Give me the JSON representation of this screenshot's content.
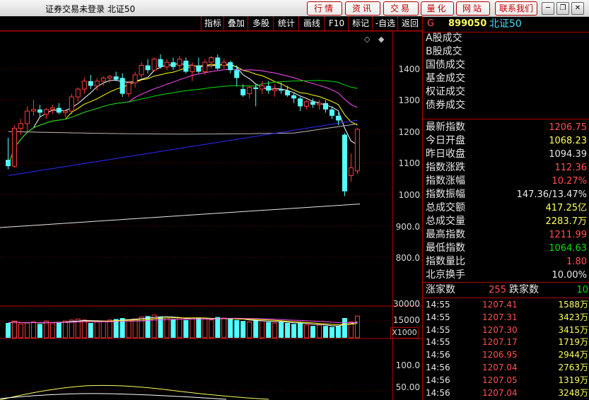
{
  "title": "证券交易未登录  北证50",
  "nav_buttons": [
    "行情",
    "资讯",
    "交易",
    "量化",
    "网站",
    "联系我们"
  ],
  "window_buttons": {
    "minimize": "─",
    "restore": "❐",
    "close": "✕"
  },
  "toolbar": [
    "指标",
    "叠加",
    "多股",
    "统计",
    "画线",
    "F10",
    "标记",
    "-自选",
    "返回"
  ],
  "chart": {
    "price_ticks": [
      "1400",
      "1300",
      "1200",
      "1100",
      "1000",
      "900.0",
      "800.0"
    ],
    "volume_ticks": [
      "30000",
      "15000"
    ],
    "volume_unit": "X1000",
    "indicator_ticks": [
      "100.0",
      "50.00"
    ],
    "colors": {
      "up": "#ff3c3c",
      "down": "#54ffff",
      "ma5": "#ffffff",
      "ma10": "#ffff00",
      "ma20": "#ff50ff",
      "ma60": "#00e000",
      "ma120": "#b8b8b8",
      "ma250": "#2a2aff",
      "ma_long": "#e8e8e8"
    }
  },
  "chart_data": {
    "type": "candlestick",
    "ylim": [
      760,
      1450
    ],
    "candles": [
      [
        1110,
        1180,
        1080,
        1090
      ],
      [
        1090,
        1220,
        1085,
        1210
      ],
      [
        1210,
        1240,
        1190,
        1225
      ],
      [
        1225,
        1280,
        1200,
        1265
      ],
      [
        1265,
        1300,
        1250,
        1270
      ],
      [
        1270,
        1285,
        1245,
        1260
      ],
      [
        1255,
        1275,
        1240,
        1270
      ],
      [
        1270,
        1285,
        1255,
        1275
      ],
      [
        1275,
        1290,
        1255,
        1260
      ],
      [
        1260,
        1270,
        1245,
        1265
      ],
      [
        1265,
        1320,
        1255,
        1310
      ],
      [
        1310,
        1340,
        1295,
        1335
      ],
      [
        1335,
        1370,
        1320,
        1360
      ],
      [
        1360,
        1380,
        1335,
        1345
      ],
      [
        1345,
        1370,
        1330,
        1360
      ],
      [
        1360,
        1375,
        1345,
        1370
      ],
      [
        1370,
        1380,
        1355,
        1375
      ],
      [
        1375,
        1390,
        1360,
        1365
      ],
      [
        1370,
        1385,
        1310,
        1320
      ],
      [
        1320,
        1360,
        1310,
        1355
      ],
      [
        1355,
        1390,
        1340,
        1380
      ],
      [
        1380,
        1420,
        1370,
        1410
      ],
      [
        1410,
        1430,
        1385,
        1395
      ],
      [
        1395,
        1435,
        1390,
        1430
      ],
      [
        1430,
        1445,
        1400,
        1405
      ],
      [
        1405,
        1430,
        1395,
        1420
      ],
      [
        1420,
        1435,
        1395,
        1405
      ],
      [
        1410,
        1440,
        1400,
        1430
      ],
      [
        1425,
        1435,
        1385,
        1390
      ],
      [
        1390,
        1420,
        1360,
        1410
      ],
      [
        1410,
        1435,
        1385,
        1390
      ],
      [
        1390,
        1430,
        1380,
        1420
      ],
      [
        1420,
        1440,
        1400,
        1435
      ],
      [
        1435,
        1445,
        1395,
        1400
      ],
      [
        1410,
        1430,
        1400,
        1420
      ],
      [
        1420,
        1425,
        1385,
        1395
      ],
      [
        1395,
        1410,
        1345,
        1370
      ],
      [
        1335,
        1350,
        1310,
        1315
      ],
      [
        1320,
        1345,
        1305,
        1340
      ],
      [
        1340,
        1350,
        1280,
        1335
      ],
      [
        1335,
        1360,
        1320,
        1345
      ],
      [
        1345,
        1360,
        1320,
        1330
      ],
      [
        1330,
        1350,
        1310,
        1335
      ],
      [
        1335,
        1355,
        1320,
        1330
      ],
      [
        1330,
        1345,
        1310,
        1315
      ],
      [
        1315,
        1325,
        1290,
        1305
      ],
      [
        1305,
        1310,
        1265,
        1280
      ],
      [
        1280,
        1300,
        1270,
        1295
      ],
      [
        1295,
        1305,
        1275,
        1285
      ],
      [
        1285,
        1300,
        1270,
        1290
      ],
      [
        1290,
        1300,
        1260,
        1270
      ],
      [
        1270,
        1280,
        1240,
        1250
      ],
      [
        1250,
        1260,
        1220,
        1235
      ],
      [
        1190,
        1195,
        995,
        1010
      ],
      [
        1060,
        1130,
        1040,
        1085
      ],
      [
        1075,
        1212,
        1065,
        1207
      ]
    ],
    "volumes": [
      15,
      17,
      14,
      15,
      16,
      14,
      17,
      15,
      16,
      17,
      18,
      19,
      18,
      15,
      16,
      17,
      18,
      19,
      20,
      18,
      19,
      21,
      22,
      23,
      21,
      20,
      19,
      20,
      18,
      19,
      20,
      19,
      18,
      21,
      20,
      19,
      18,
      17,
      16,
      18,
      17,
      16,
      15,
      16,
      15,
      14,
      15,
      13,
      12,
      13,
      12,
      11,
      12,
      20,
      16,
      22
    ]
  },
  "quote": {
    "flag": "G",
    "code": "899050",
    "name": "北证50",
    "categories": [
      "A股成交",
      "B股成交",
      "国债成交",
      "基金成交",
      "权证成交",
      "债券成交"
    ],
    "stats": [
      {
        "label": "最新指数",
        "value": "1206.75",
        "color": "red"
      },
      {
        "label": "今日开盘",
        "value": "1068.23",
        "color": "yellow"
      },
      {
        "label": "昨日收盘",
        "value": "1094.39",
        "color": "white"
      },
      {
        "label": "指数涨跌",
        "value": "112.36",
        "color": "red"
      },
      {
        "label": "指数涨幅",
        "value": "10.27%",
        "color": "red"
      },
      {
        "label": "指数振幅",
        "value": "147.36/13.47%",
        "color": "white"
      },
      {
        "label": "总成交额",
        "value": "417.25亿",
        "color": "yellow"
      },
      {
        "label": "总成交量",
        "value": "2283.7万",
        "color": "yellow"
      },
      {
        "label": "最高指数",
        "value": "1211.99",
        "color": "red"
      },
      {
        "label": "最低指数",
        "value": "1064.63",
        "color": "green"
      },
      {
        "label": "指数量比",
        "value": "1.80",
        "color": "red"
      },
      {
        "label": "北京换手",
        "value": "10.00%",
        "color": "white"
      }
    ],
    "up_label": "涨家数",
    "up_count": "255",
    "down_label": "跌家数",
    "down_count": "10",
    "ticks": [
      {
        "time": "14:55",
        "price": "1207.41",
        "vol": "1588万"
      },
      {
        "time": "14:55",
        "price": "1207.31",
        "vol": "3423万"
      },
      {
        "time": "14:55",
        "price": "1207.30",
        "vol": "3415万"
      },
      {
        "time": "14:55",
        "price": "1207.17",
        "vol": "1719万"
      },
      {
        "time": "14:56",
        "price": "1206.95",
        "vol": "2944万"
      },
      {
        "time": "14:56",
        "price": "1207.04",
        "vol": "2763万"
      },
      {
        "time": "14:56",
        "price": "1207.05",
        "vol": "1319万"
      },
      {
        "time": "14:56",
        "price": "1207.04",
        "vol": "3248万"
      }
    ]
  }
}
